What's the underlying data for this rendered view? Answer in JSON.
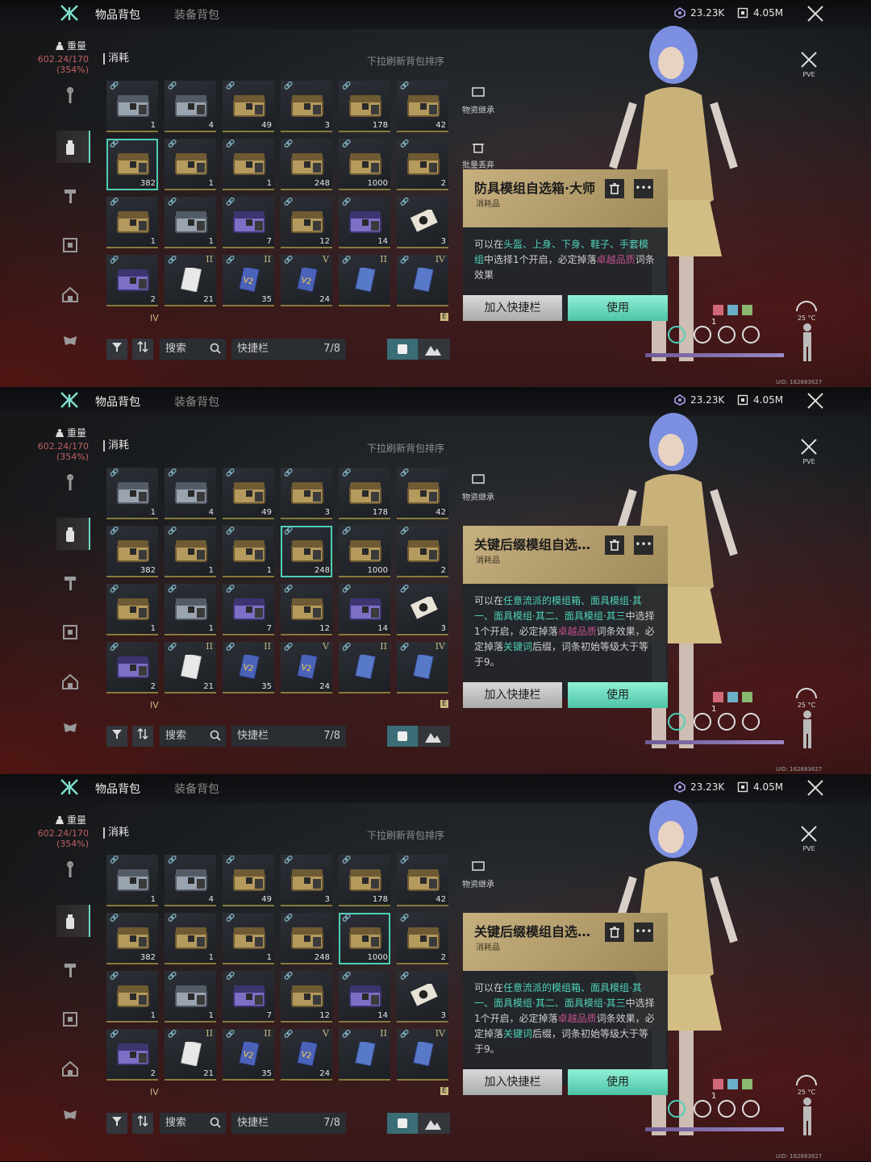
{
  "tabs": {
    "items": "物品背包",
    "equipment": "装备背包"
  },
  "currency": {
    "a": "23.23K",
    "b": "4.05M"
  },
  "weight": {
    "label": "重量",
    "value": "602.24/170",
    "percent": "(354%)"
  },
  "section": {
    "title": "消耗",
    "sort_hint": "下拉刷新背包排序"
  },
  "grid": {
    "cells": [
      {
        "count": "1",
        "kind": "silver"
      },
      {
        "count": "4",
        "kind": "silver"
      },
      {
        "count": "49",
        "kind": "gold"
      },
      {
        "count": "3",
        "kind": "gold"
      },
      {
        "count": "178",
        "kind": "gold"
      },
      {
        "count": "42",
        "kind": "gold"
      },
      {
        "count": "382",
        "kind": "gold"
      },
      {
        "count": "1",
        "kind": "gold"
      },
      {
        "count": "1",
        "kind": "gold"
      },
      {
        "count": "248",
        "kind": "gold"
      },
      {
        "count": "1000",
        "kind": "gold"
      },
      {
        "count": "2",
        "kind": "gold"
      },
      {
        "count": "1",
        "kind": "gold"
      },
      {
        "count": "1",
        "kind": "silver"
      },
      {
        "count": "7",
        "kind": "purple"
      },
      {
        "count": "12",
        "kind": "gold"
      },
      {
        "count": "14",
        "kind": "purple"
      },
      {
        "count": "3",
        "kind": "ticket"
      },
      {
        "count": "2",
        "kind": "purple",
        "roman": ""
      },
      {
        "count": "21",
        "kind": "card",
        "roman": "II"
      },
      {
        "count": "35",
        "kind": "v2",
        "roman": "II"
      },
      {
        "count": "24",
        "kind": "v2",
        "roman": "V"
      },
      {
        "count": "",
        "kind": "tab",
        "roman": "II"
      },
      {
        "count": "",
        "kind": "tab",
        "roman": "IV"
      }
    ],
    "strip": {
      "roman": "IV",
      "letter": "E"
    }
  },
  "toolbar": {
    "search": "搜索",
    "quick": "快捷栏",
    "quick_count": "7/8"
  },
  "side_actions": {
    "inherit": "物资继承",
    "discard": "批量丢弃"
  },
  "panels": [
    {
      "selected_index": 6,
      "title": "防具模组自选箱·大师",
      "subtitle": "消耗品",
      "desc": [
        {
          "t": "可以在"
        },
        {
          "t": "头盔、上身、下身、鞋子、手套模组",
          "c": "teal"
        },
        {
          "t": "中选择1个开启，必定掉落"
        },
        {
          "t": "卓越品质",
          "c": "pink"
        },
        {
          "t": "词条效果"
        }
      ],
      "show_discard": true
    },
    {
      "selected_index": 9,
      "title": "关键后缀模组自选…",
      "subtitle": "消耗品",
      "desc": [
        {
          "t": "可以在"
        },
        {
          "t": "任意流派的模组箱、面具模组·其一、面具模组·其二、面具模组·其三",
          "c": "teal"
        },
        {
          "t": "中选择1个开启，必定掉落"
        },
        {
          "t": "卓越品质",
          "c": "pink"
        },
        {
          "t": "词条效果，必定掉落"
        },
        {
          "t": "关键词",
          "c": "teal"
        },
        {
          "t": "后缀，词条初始等级大于等于9。"
        }
      ],
      "show_discard": false
    },
    {
      "selected_index": 10,
      "title": "关键后缀模组自选…",
      "subtitle": "消耗品",
      "desc": [
        {
          "t": "可以在"
        },
        {
          "t": "任意流派的模组箱、面具模组·其一、面具模组·其二、面具模组·其三",
          "c": "teal"
        },
        {
          "t": "中选择1个开启，必定掉落"
        },
        {
          "t": "卓越品质",
          "c": "pink"
        },
        {
          "t": "词条效果，必定掉落"
        },
        {
          "t": "关键词",
          "c": "teal"
        },
        {
          "t": "后缀，词条初始等级大于等于9。"
        }
      ],
      "show_discard": false
    }
  ],
  "actions": {
    "quickbar": "加入快捷栏",
    "use": "使用"
  },
  "mode": "PVE",
  "temperature": "25 °C",
  "status_count": "1",
  "uid": "UID: 162883627",
  "colors": {
    "accent": "#4fd2b8",
    "highlight": "#c0508c",
    "popup_header": "#c7b080"
  }
}
